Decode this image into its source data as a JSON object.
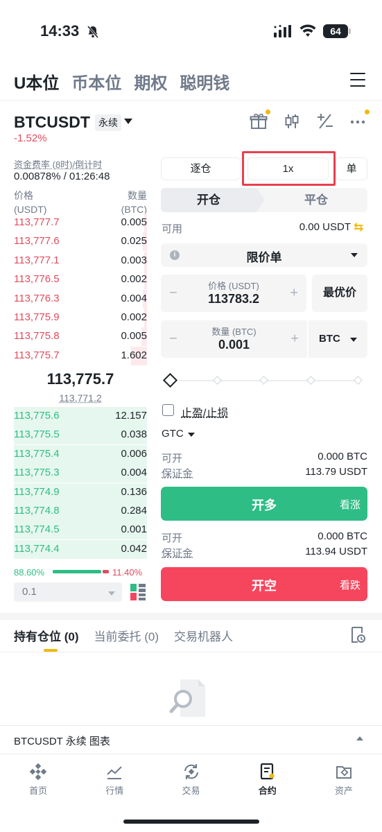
{
  "status": {
    "time": "14:33",
    "battery": "64"
  },
  "main_tabs": [
    "U本位",
    "币本位",
    "期权",
    "聪明钱"
  ],
  "header": {
    "symbol": "BTCUSDT",
    "contract_type": "永续",
    "change": "-1.52%"
  },
  "funding": {
    "label": "资金费率 (8时)/倒计时",
    "value": "0.00878% / 01:26:48"
  },
  "orderbook": {
    "price_header": "价格",
    "price_unit": "(USDT)",
    "qty_header": "数量",
    "qty_unit": "(BTC)",
    "asks": [
      {
        "price": "113,777.7",
        "qty": "0.005",
        "depth": 0.02
      },
      {
        "price": "113,777.6",
        "qty": "0.025",
        "depth": 0.03
      },
      {
        "price": "113,777.1",
        "qty": "0.003",
        "depth": 0.02
      },
      {
        "price": "113,776.5",
        "qty": "0.002",
        "depth": 0.02
      },
      {
        "price": "113,776.3",
        "qty": "0.004",
        "depth": 0.03
      },
      {
        "price": "113,775.9",
        "qty": "0.002",
        "depth": 0.02
      },
      {
        "price": "113,775.8",
        "qty": "0.005",
        "depth": 0.04
      },
      {
        "price": "113,775.7",
        "qty": "1.602",
        "depth": 0.12
      }
    ],
    "last_price": "113,775.7",
    "mark_price": "113,771.2",
    "bids": [
      {
        "price": "113,775.6",
        "qty": "12.157",
        "depth": 1.0
      },
      {
        "price": "113,775.5",
        "qty": "0.038",
        "depth": 1.0
      },
      {
        "price": "113,775.4",
        "qty": "0.006",
        "depth": 1.0
      },
      {
        "price": "113,775.3",
        "qty": "0.004",
        "depth": 1.0
      },
      {
        "price": "113,774.9",
        "qty": "0.136",
        "depth": 1.0
      },
      {
        "price": "113,774.8",
        "qty": "0.284",
        "depth": 1.0
      },
      {
        "price": "113,774.5",
        "qty": "0.001",
        "depth": 1.0
      },
      {
        "price": "113,774.4",
        "qty": "0.042",
        "depth": 1.0
      }
    ],
    "buy_ratio": "88.60%",
    "sell_ratio": "11.40%",
    "precision": "0.1"
  },
  "order_form": {
    "margin_mode": "逐仓",
    "leverage": "1x",
    "position_mode": "单",
    "open_tab": "开仓",
    "close_tab": "平仓",
    "available_label": "可用",
    "available_value": "0.00 USDT",
    "order_type": "限价单",
    "price_label": "价格 (USDT)",
    "price_value": "113783.2",
    "best_price": "最优价",
    "qty_label": "数量 (BTC)",
    "qty_value": "0.001",
    "qty_unit": "BTC",
    "tpsl_label": "止盈/止损",
    "tif": "GTC",
    "long": {
      "can_open_label": "可开",
      "can_open_value": "0.000 BTC",
      "margin_label": "保证金",
      "margin_value": "113.79 USDT",
      "button": "开多",
      "sub": "看涨",
      "color": "#2ebd85"
    },
    "short": {
      "can_open_label": "可开",
      "can_open_value": "0.000 BTC",
      "margin_label": "保证金",
      "margin_value": "113.94 USDT",
      "button": "开空",
      "sub": "看跌",
      "color": "#f6465d"
    }
  },
  "positions": {
    "tabs": [
      "持有仓位 (0)",
      "当前委托 (0)",
      "交易机器人"
    ]
  },
  "chart_bar": {
    "label": "BTCUSDT 永续  图表"
  },
  "nav": [
    "首页",
    "行情",
    "交易",
    "合约",
    "资产"
  ]
}
